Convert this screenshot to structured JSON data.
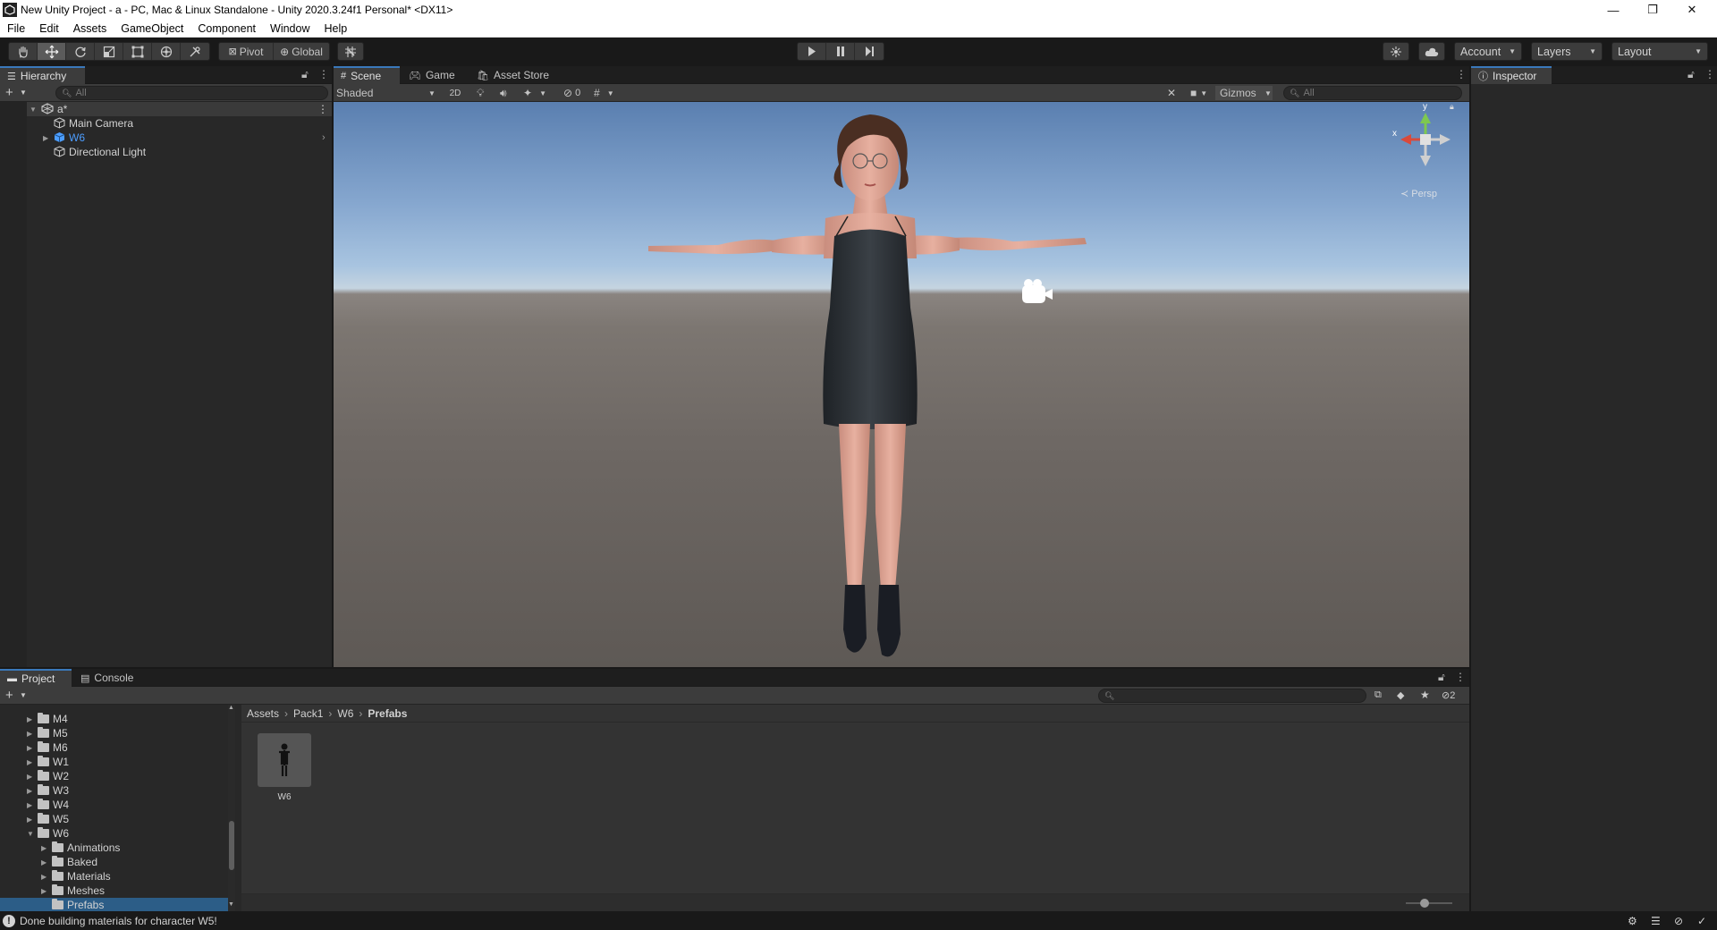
{
  "window": {
    "title": "New Unity Project - a - PC, Mac & Linux Standalone - Unity 2020.3.24f1 Personal* <DX11>",
    "minimize": "—",
    "restore": "❐",
    "close": "✕"
  },
  "menu": [
    "File",
    "Edit",
    "Assets",
    "GameObject",
    "Component",
    "Window",
    "Help"
  ],
  "toolbar": {
    "pivot_label": "Pivot",
    "global_label": "Global",
    "account_label": "Account",
    "layers_label": "Layers",
    "layout_label": "Layout"
  },
  "hierarchy": {
    "tab_label": "Hierarchy",
    "search_placeholder": "All",
    "scene_name": "a*",
    "items": [
      {
        "name": "Main Camera"
      },
      {
        "name": "W6",
        "color": "#4c9dff"
      },
      {
        "name": "Directional Light"
      }
    ]
  },
  "scene": {
    "tabs": [
      "Scene",
      "Game",
      "Asset Store"
    ],
    "shading_mode": "Shaded",
    "mode_2d": "2D",
    "hidden_count": "0",
    "gizmos_label": "Gizmos",
    "search_placeholder": "All",
    "persp_label": "Persp",
    "axis_x": "x",
    "axis_y": "y"
  },
  "inspector": {
    "tab_label": "Inspector"
  },
  "project": {
    "tabs": [
      "Project",
      "Console"
    ],
    "visible_count": "2",
    "breadcrumb": [
      "Assets",
      "Pack1",
      "W6",
      "Prefabs"
    ],
    "tree_top": [
      {
        "name": "M4"
      },
      {
        "name": "M5"
      },
      {
        "name": "M6"
      },
      {
        "name": "W1"
      },
      {
        "name": "W2"
      },
      {
        "name": "W3"
      },
      {
        "name": "W4"
      },
      {
        "name": "W5"
      },
      {
        "name": "W6"
      }
    ],
    "tree_w6_children": [
      {
        "name": "Animations"
      },
      {
        "name": "Baked"
      },
      {
        "name": "Materials"
      },
      {
        "name": "Meshes"
      },
      {
        "name": "Prefabs"
      }
    ],
    "assets": [
      {
        "name": "W6"
      }
    ],
    "slider_value": 0.4
  },
  "status": {
    "message": "Done building materials for character W5!"
  },
  "colors": {
    "accent": "#3a79bb",
    "selection": "#2c5d87",
    "panel_bg": "#282828",
    "toolbar_bg": "#191919"
  }
}
